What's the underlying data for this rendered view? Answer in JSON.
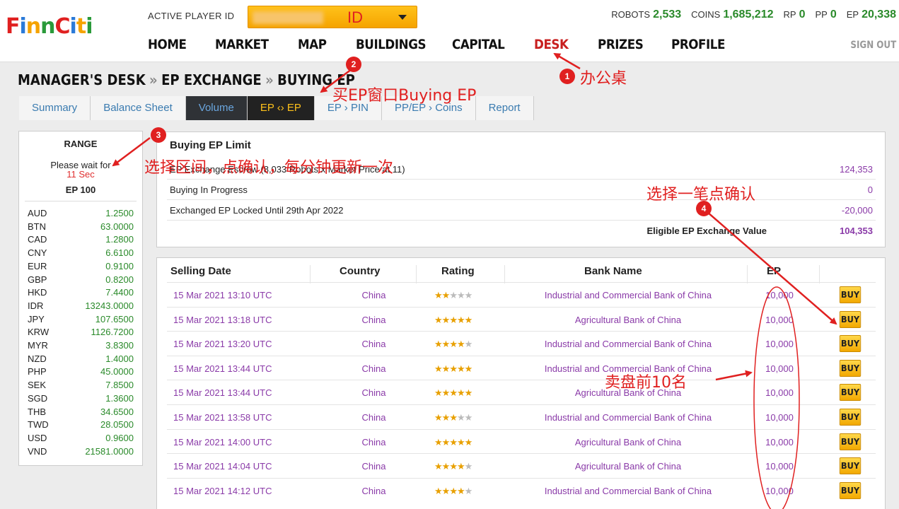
{
  "header": {
    "logo": "FinnCiti",
    "player_label": "ACTIVE PLAYER ID",
    "player_select_text": "ID",
    "stats": [
      {
        "label": "ROBOTS",
        "value": "2,533"
      },
      {
        "label": "COINS",
        "value": "1,685,212"
      },
      {
        "label": "RP",
        "value": "0"
      },
      {
        "label": "PP",
        "value": "0"
      },
      {
        "label": "EP",
        "value": "20,338"
      }
    ],
    "nav": [
      "HOME",
      "MARKET",
      "MAP",
      "BUILDINGS",
      "CAPITAL",
      "DESK",
      "PRIZES",
      "PROFILE"
    ],
    "active_nav": "DESK",
    "signout": "SIGN OUT"
  },
  "breadcrumb": [
    "MANAGER'S DESK",
    "EP EXCHANGE",
    "BUYING EP"
  ],
  "tabs": [
    "Summary",
    "Balance Sheet",
    "Volume",
    "EP ‹› EP",
    "EP › PIN",
    "PP/EP › Coins",
    "Report"
  ],
  "range": {
    "title": "RANGE",
    "wait_text": "Please wait for",
    "wait_sec": "11 Sec",
    "ep_label": "EP 100",
    "currencies": [
      {
        "code": "AUD",
        "rate": "1.2500"
      },
      {
        "code": "BTN",
        "rate": "63.0000"
      },
      {
        "code": "CAD",
        "rate": "1.2800"
      },
      {
        "code": "CNY",
        "rate": "6.6100"
      },
      {
        "code": "EUR",
        "rate": "0.9100"
      },
      {
        "code": "GBP",
        "rate": "0.8200"
      },
      {
        "code": "HKD",
        "rate": "7.4400"
      },
      {
        "code": "IDR",
        "rate": "13243.0000"
      },
      {
        "code": "JPY",
        "rate": "107.6500"
      },
      {
        "code": "KRW",
        "rate": "1126.7200"
      },
      {
        "code": "MYR",
        "rate": "3.8300"
      },
      {
        "code": "NZD",
        "rate": "1.4000"
      },
      {
        "code": "PHP",
        "rate": "45.0000"
      },
      {
        "code": "SEK",
        "rate": "7.8500"
      },
      {
        "code": "SGD",
        "rate": "1.3600"
      },
      {
        "code": "THB",
        "rate": "34.6500"
      },
      {
        "code": "TWD",
        "rate": "28.0500"
      },
      {
        "code": "USD",
        "rate": "0.9600"
      },
      {
        "code": "VND",
        "rate": "21581.0000"
      }
    ]
  },
  "limit": {
    "title": "Buying EP Limit",
    "rows": [
      {
        "label": "EP Exchange Escrow (8,033 Robots x Market Price at 11)",
        "value": "124,353"
      },
      {
        "label": "Buying In Progress",
        "value": "0"
      },
      {
        "label": "Exchanged EP Locked Until 29th Apr 2022",
        "value": "-20,000"
      }
    ],
    "total_label": "Eligible EP Exchange Value",
    "total_value": "104,353"
  },
  "orders": {
    "headers": {
      "date": "Selling Date",
      "country": "Country",
      "rating": "Rating",
      "bank": "Bank Name",
      "ep": "EP"
    },
    "buy_label": "BUY",
    "rows": [
      {
        "date": "15 Mar 2021  13:10 UTC",
        "country": "China",
        "rating": 2,
        "bank": "Industrial and Commercial Bank of China",
        "ep": "10,000"
      },
      {
        "date": "15 Mar 2021  13:18 UTC",
        "country": "China",
        "rating": 5,
        "bank": "Agricultural Bank of China",
        "ep": "10,000"
      },
      {
        "date": "15 Mar 2021  13:20 UTC",
        "country": "China",
        "rating": 4,
        "bank": "Industrial and Commercial Bank of China",
        "ep": "10,000"
      },
      {
        "date": "15 Mar 2021  13:44 UTC",
        "country": "China",
        "rating": 5,
        "bank": "Industrial and Commercial Bank of China",
        "ep": "10,000"
      },
      {
        "date": "15 Mar 2021  13:44 UTC",
        "country": "China",
        "rating": 5,
        "bank": "Agricultural Bank of China",
        "ep": "10,000"
      },
      {
        "date": "15 Mar 2021  13:58 UTC",
        "country": "China",
        "rating": 3,
        "bank": "Industrial and Commercial Bank of China",
        "ep": "10,000"
      },
      {
        "date": "15 Mar 2021  14:00 UTC",
        "country": "China",
        "rating": 5,
        "bank": "Agricultural Bank of China",
        "ep": "10,000"
      },
      {
        "date": "15 Mar 2021  14:04 UTC",
        "country": "China",
        "rating": 4,
        "bank": "Agricultural Bank of China",
        "ep": "10,000"
      },
      {
        "date": "15 Mar 2021  14:12 UTC",
        "country": "China",
        "rating": 4,
        "bank": "Industrial and Commercial Bank of China",
        "ep": "10,000"
      }
    ]
  },
  "annotations": {
    "a1": {
      "num": "1",
      "text": "办公桌"
    },
    "a2": {
      "num": "2",
      "text": "买EP窗口Buying EP"
    },
    "a3": {
      "num": "3",
      "text": "选择区间，点确认，每分钟更新一次"
    },
    "a4": {
      "num": "4",
      "text": "选择一笔点确认"
    },
    "a5": {
      "text": "卖盘前10名"
    }
  },
  "colors": {
    "accent": "#f5a300",
    "green": "#2a8a2a",
    "purple": "#8a3aa8",
    "annotation": "#e02020"
  }
}
